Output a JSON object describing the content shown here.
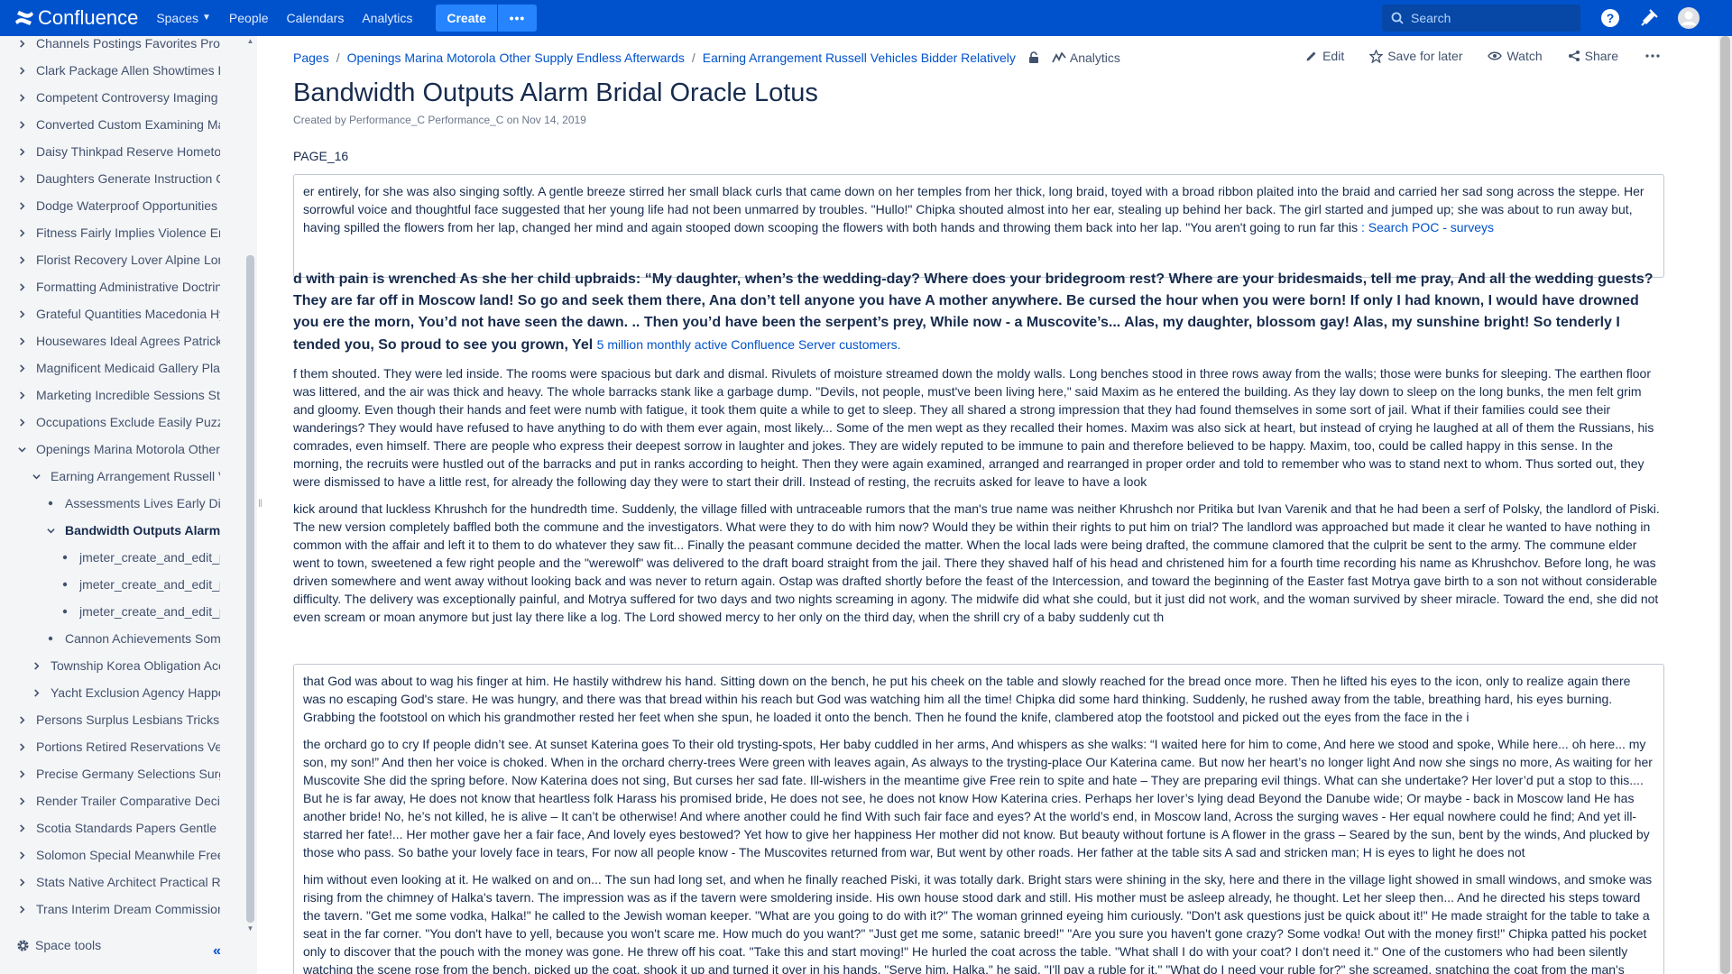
{
  "topnav": {
    "logo_text": "Confluence",
    "spaces": "Spaces",
    "people": "People",
    "calendars": "Calendars",
    "analytics": "Analytics",
    "create": "Create",
    "more": "•••",
    "search_placeholder": "Search",
    "brand_color": "#0052cc"
  },
  "sidebar": {
    "items": [
      {
        "label": "Channels Postings Favorites Prof",
        "twisty": "right"
      },
      {
        "label": "Clark Package Allen Showtimes E",
        "twisty": "right"
      },
      {
        "label": "Competent Controversy Imaging I",
        "twisty": "right"
      },
      {
        "label": "Converted Custom Examining Ma",
        "twisty": "right"
      },
      {
        "label": "Daisy Thinkpad Reserve Hometov",
        "twisty": "right"
      },
      {
        "label": "Daughters Generate Instruction C",
        "twisty": "right"
      },
      {
        "label": "Dodge Waterproof Opportunities D",
        "twisty": "right"
      },
      {
        "label": "Fitness Fairly Implies Violence En",
        "twisty": "right"
      },
      {
        "label": "Florist Recovery Lover Alpine Lon",
        "twisty": "right"
      },
      {
        "label": "Formatting Administrative Doctrine",
        "twisty": "right"
      },
      {
        "label": "Grateful Quantities Macedonia Hy",
        "twisty": "right"
      },
      {
        "label": "Housewares Ideal Agrees Patrick",
        "twisty": "right"
      },
      {
        "label": "Magnificent Medicaid Gallery Plar",
        "twisty": "right"
      },
      {
        "label": "Marketing Incredible Sessions Stc",
        "twisty": "right"
      },
      {
        "label": "Occupations Exclude Easily Puzzl",
        "twisty": "right"
      },
      {
        "label": "Openings Marina Motorola Other",
        "twisty": "down"
      },
      {
        "label": "Earning Arrangement Russell Ve",
        "twisty": "down"
      },
      {
        "label": "Assessments Lives Early Dies",
        "twisty": "dot"
      },
      {
        "label": "Bandwidth Outputs Alarm B",
        "twisty": "down"
      },
      {
        "label": "jmeter_create_and_edit_pa",
        "twisty": "dot"
      },
      {
        "label": "jmeter_create_and_edit_pa",
        "twisty": "dot"
      },
      {
        "label": "jmeter_create_and_edit_pa",
        "twisty": "dot"
      },
      {
        "label": "Cannon Achievements Somel",
        "twisty": "dot"
      },
      {
        "label": "Township Korea Obligation Acce",
        "twisty": "right"
      },
      {
        "label": "Yacht Exclusion Agency Happer",
        "twisty": "right"
      },
      {
        "label": "Persons Surplus Lesbians Tricks I",
        "twisty": "right"
      },
      {
        "label": "Portions Retired Reservations Vel",
        "twisty": "right"
      },
      {
        "label": "Precise Germany Selections Surg",
        "twisty": "right"
      },
      {
        "label": "Render Trailer Comparative Decis",
        "twisty": "right"
      },
      {
        "label": "Scotia Standards Papers Gentle C",
        "twisty": "right"
      },
      {
        "label": "Solomon Special Meanwhile Free",
        "twisty": "right"
      },
      {
        "label": "Stats Native Architect Practical Re",
        "twisty": "right"
      },
      {
        "label": "Trans Interim Dream Commission",
        "twisty": "right"
      }
    ],
    "space_tools": "Space tools",
    "collapse": "«"
  },
  "breadcrumbs": {
    "items": [
      "Pages",
      "Openings Marina Motorola Other Supply Endless Afterwards",
      "Earning Arrangement Russell Vehicles Bidder Relatively"
    ],
    "analytics": "Analytics"
  },
  "actions": {
    "edit": "Edit",
    "save": "Save for later",
    "watch": "Watch",
    "share": "Share"
  },
  "page": {
    "title": "Bandwidth Outputs Alarm Bridal Oracle Lotus",
    "created_prefix": "Created by ",
    "author": "Performance_C Performance_C",
    "created_on": " on ",
    "date": "Nov 14, 2019",
    "code": "PAGE_16",
    "panel1_text": " er entirely, for she was also singing softly. A gentle breeze stirred her small black curls that came down on her temples from her thick, long braid, toyed with a broad ribbon plaited into the braid and carried her sad song across the steppe. Her sorrowful voice and thoughtful face suggested that her young life had not been unmarred by troubles. \"Hullo!\" Chipka shouted almost into her ear, stealing up behind her back. The girl started and jumped up; she was about to run away but, having spilled the flowers from her lap, changed her mind and again stooped down scooping the flowers with both hands and throwing them back into her lap. \"You aren't going to run far this ",
    "panel1_link": ": Search POC - surveys",
    "bold_text": "d with pain is wrenched As she her child upbraids: “My daughter, when’s the wedding-day? Where does your bridegroom rest? Where are your bridesmaids, tell me pray, And all the wedding guests? They are far off in Moscow land! So go and seek them there, Ana don’t tell anyone you have A mother anywhere. Be cursed the hour when you were born! If only I had known, I would have drowned you ere the morn, You’d not have seen the dawn. .. Then you’d have been the serpent’s prey, While now - a Muscovite’s... Alas, my daughter, blossom gay! Alas, my sunshine bright! So tenderly I tended you, So proud to see you grown, Yel ",
    "bold_link": "5 million monthly active Confluence Server customers.",
    "para1": "f them shouted. They were led inside. The rooms were spacious but dark and dismal. Rivulets of moisture streamed down the moldy walls. Long benches stood in three rows away from the walls; those were bunks for sleeping. The earthen floor was littered, and the air was thick and heavy. The whole barracks stank like a garbage dump. \"Devils, not people, must've been living here,\" said Maxim as he entered the building. As they lay down to sleep on the long bunks, the men felt grim and gloomy. Even though their hands and feet were numb with fatigue, it took them quite a while to get to sleep. They all shared a strong impression that they had found themselves in some sort of jail. What if their families could see their wanderings? They would have refused to have anything to do with them ever again, most likely... Some of the men wept as they recalled their homes. Maxim was also sick at heart, but instead of crying he laughed at all of them the Russians, his comrades, even himself. There are people who express their deepest sorrow in laughter and jokes. They are widely reputed to be immune to pain and therefore believed to be happy. Maxim, too, could be called happy in this sense. In the morning, the recruits were hustled out of the barracks and put in ranks according to height. Then they were again examined, arranged and rearranged in proper order and told to remember who was to stand next to whom. Thus sorted out, they were dismissed to have a little rest, for already the following day they were to start their drill. Instead of resting, the recruits asked for leave to have a look",
    "para2": "kick around that luckless Khrushch for the hundredth time. Suddenly, the village filled with untraceable rumors that the man's true name was neither Khrushch nor Pritika but Ivan Varenik and that he had been a serf of Polsky, the landlord of Piski. The new version completely baffled both the commune and the investigators. What were they to do with him now? Would they be within their rights to put him on trial? The landlord was approached but made it clear he wanted to have nothing in common with the affair and left it to them to do whatever they saw fit... Finally the peasant commune decided the matter. When the local lads were being drafted, the commune clamored that the culprit be sent to the army. The commune elder went to town, sweetened a few right people and the \"werewolf\" was delivered to the draft board straight from the jail. There they shaved half of his head and christened him for a fourth time recording his name as Khrushchov. Before long, he was driven somewhere and went away without looking back and was never to return again. Ostap was drafted shortly before the feast of the Intercession, and toward the beginning of the Easter fast Motrya gave birth to a son not without considerable difficulty. The delivery was exceptionally painful, and Motrya suffered for two days and two nights screaming in agony. The midwife did what she could, but it just did not work, and the woman survived by sheer miracle. Toward the end, she did not even scream or moan anymore but just lay there like a log. The Lord showed mercy to her only on the third day, when the shrill cry of a baby suddenly cut th",
    "panel2_p1": "that God was about to wag his finger at him. He hastily withdrew his hand. Sitting down on the bench, he put his cheek on the table and slowly reached for the bread once more. Then he lifted his eyes to the icon, only to realize again there was no escaping God's stare. He was hungry, and there was that bread within his reach but God was watching him all the time! Chipka did some hard thinking. Suddenly, he rushed away from the table, breathing hard, his eyes burning. Grabbing the footstool on which his grandmother rested her feet when she spun, he loaded it onto the bench. Then he found the knife, clambered atop the footstool and picked out the eyes from the face in the i",
    "panel2_p2": "the orchard go to cry If people didn’t see. At sunset Katerina goes To their old trysting-spots, Her baby cuddled in her arms, And whispers as she walks: “I waited here for him to come, And here we stood and spoke, While here... oh here... my son, my son!” And then her voice is choked. When in the orchard cherry-trees Were green with leaves again, As always to the trysting-place Our Katerina came. But now her heart’s no longer light And now she sings no more, As waiting for her Muscovite She did the spring before. Now Katerina does not sing, But curses her sad fate. Ill-wishers in the meantime give Free rein to spite and hate – They are preparing evil things. What can she undertake? Her lover’d put a stop to this.... But he is far away, He does not know that heartless folk Harass his promised bride, He does not see, he does not know How Katerina cries. Perhaps her lover’s lying dead Beyond the Danube wide; Or maybe - back in Moscow land He has another bride! No, he’s not killed, he is alive – It can’t be otherwise! And where another could he find With such fair face and eyes? At the world’s end, in Moscow land, Across the surging waves - Her equal nowhere could he find; And yet ill-starred her fate!... Her mother gave her a fair face, And lovely eyes bestowed? Yet how to give her happiness Her mother did not know. But beauty without fortune is A flower in the grass – Seared by the sun, bent by the winds, And plucked by those who pass. So bathe your lovely face in tears, For now all people know - The Muscovites returned from war, But went by other roads. Her father at the table sits A sad and stricken man; H is eyes to light he does not",
    "panel2_p3": "him without even looking at it. He walked on and on... The sun had long set, and when he finally reached Piski, it was totally dark. Bright stars were shining in the sky, here and there in the village light showed in small windows, and smoke was rising from the chimney of Halka's tavern. The impression was as if the tavern were smoldering inside. His own house stood dark and still. His mother must be asleep already, he thought. Let her sleep then... And he directed his steps toward the tavern. \"Get me some vodka, Halka!\" he called to the Jewish woman keeper. \"What are you going to do with it?\" The woman grinned eyeing him curiously. \"Don't ask questions just be quick about it!\" He made straight for the table to take a seat in the far corner. \"You don't have to yell, because you won't scare me. How much do you want?\" \"Just get me some, satanic breed!\" \"Are you sure you haven't gone crazy? Some vodka! Out with the money first!\" Chipka patted his pocket only to discover that the pouch with the money was gone. He threw off his coat. \"Take this and start moving!\" He hurled the coat across the table. \"What shall I do with your coat? I don't need it.\" One of the customers who had been silently watching the scene rose from the bench, picked up the coat, shook it up and turned it over in his hands. \"Serve him, Halka,\" he said. \"I'll pay a ruble for it.\" \"What do I need your ruble for?\" she screamed, snatching the coat from the man's"
  }
}
